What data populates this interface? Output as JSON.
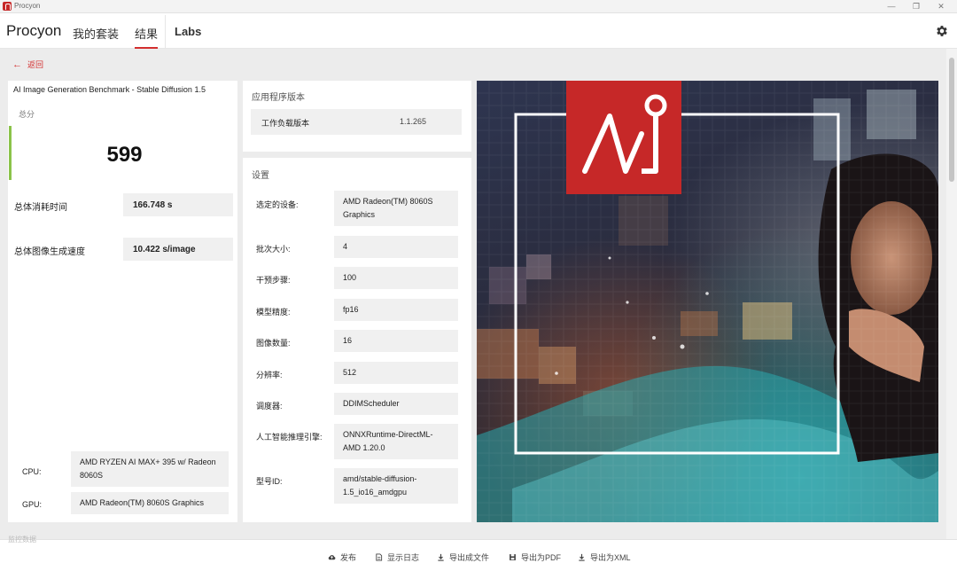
{
  "window": {
    "title": "Procyon",
    "min": "—",
    "max": "❐",
    "close": "✕"
  },
  "nav": {
    "brand": "Procyon",
    "tabs": [
      {
        "label": "我的套装"
      },
      {
        "label": "结果"
      },
      {
        "label": "Labs"
      }
    ]
  },
  "back_label": "返回",
  "result": {
    "benchmark_title": "AI Image Generation Benchmark - Stable Diffusion 1.5",
    "total_label": "总分",
    "score": "599",
    "metrics": [
      {
        "label": "总体消耗时间",
        "value": "166.748 s"
      },
      {
        "label": "总体图像生成速度",
        "value": "10.422 s/image"
      }
    ],
    "hardware": [
      {
        "label": "CPU:",
        "value": "AMD RYZEN AI MAX+ 395 w/ Radeon 8060S"
      },
      {
        "label": "GPU:",
        "value": "AMD Radeon(TM) 8060S Graphics"
      }
    ]
  },
  "app_version": {
    "title": "应用程序版本",
    "label": "工作负载版本",
    "value": "1.1.265"
  },
  "settings": {
    "title": "设置",
    "rows": [
      {
        "label": "选定的设备:",
        "value": "AMD Radeon(TM) 8060S Graphics"
      },
      {
        "label": "批次大小:",
        "value": "4"
      },
      {
        "label": "干预步骤:",
        "value": "100"
      },
      {
        "label": "模型精度:",
        "value": "fp16"
      },
      {
        "label": "图像数量:",
        "value": "16"
      },
      {
        "label": "分辨率:",
        "value": "512"
      },
      {
        "label": "调度器:",
        "value": "DDIMScheduler"
      },
      {
        "label": "人工智能推理引擎:",
        "value": "ONNXRuntime-DirectML-AMD 1.20.0"
      },
      {
        "label": "型号ID:",
        "value": "amd/stable-diffusion-1.5_io16_amdgpu"
      }
    ]
  },
  "bottom_ghost": "监控数据",
  "actions": [
    {
      "label": "发布",
      "icon": "cloud-upload-icon"
    },
    {
      "label": "显示日志",
      "icon": "document-icon"
    },
    {
      "label": "导出成文件",
      "icon": "download-icon"
    },
    {
      "label": "导出为PDF",
      "icon": "save-icon"
    },
    {
      "label": "导出为XML",
      "icon": "download-icon"
    }
  ],
  "colors": {
    "accent": "#d32f2f",
    "score_bar": "#8bc34a",
    "logo_red": "#c62828"
  }
}
